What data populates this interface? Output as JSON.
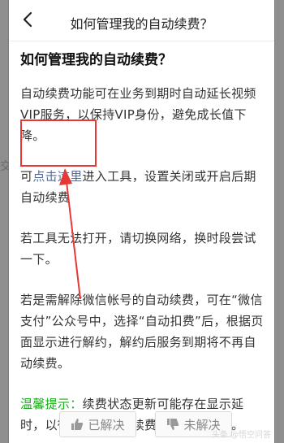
{
  "side": {
    "left_glyph": "交"
  },
  "header": {
    "back_icon": "chevron-left-icon",
    "title": "如何管理我的自动续费？"
  },
  "article": {
    "title": "如何管理我的自动续费？",
    "p1": "自动续费功能可在业务到期时自动延长视频VIP服务，以保持VIP身份，避免成长值下降。",
    "p2_prefix": "可",
    "p2_link": "点击这里",
    "p2_suffix": "进入工具，设置关闭或开启后期自动续费",
    "p3": "若工具无法打开，请切换网络，换时段尝试一下。",
    "p4": "若是需解除微信帐号的自动续费，可在“微信支付”公众号中，选择“自动扣费”后，根据页面显示进行解约，解约后服务到期将不再自动续费。",
    "tip_label": "温馨提示：",
    "tip_text": "续费状态更新可能存在显示延时，以微信支付自动续费签约状态为准。"
  },
  "feedback": {
    "solved_label": "已解决",
    "unsolved_label": "未解决",
    "solved_icon": "thumbs-up-icon",
    "unsolved_icon": "thumbs-down-icon"
  },
  "watermark": "头条 @悟空问答",
  "colors": {
    "link": "#576b95",
    "tip_green": "#1aad19",
    "annotation_red": "#e53935"
  }
}
